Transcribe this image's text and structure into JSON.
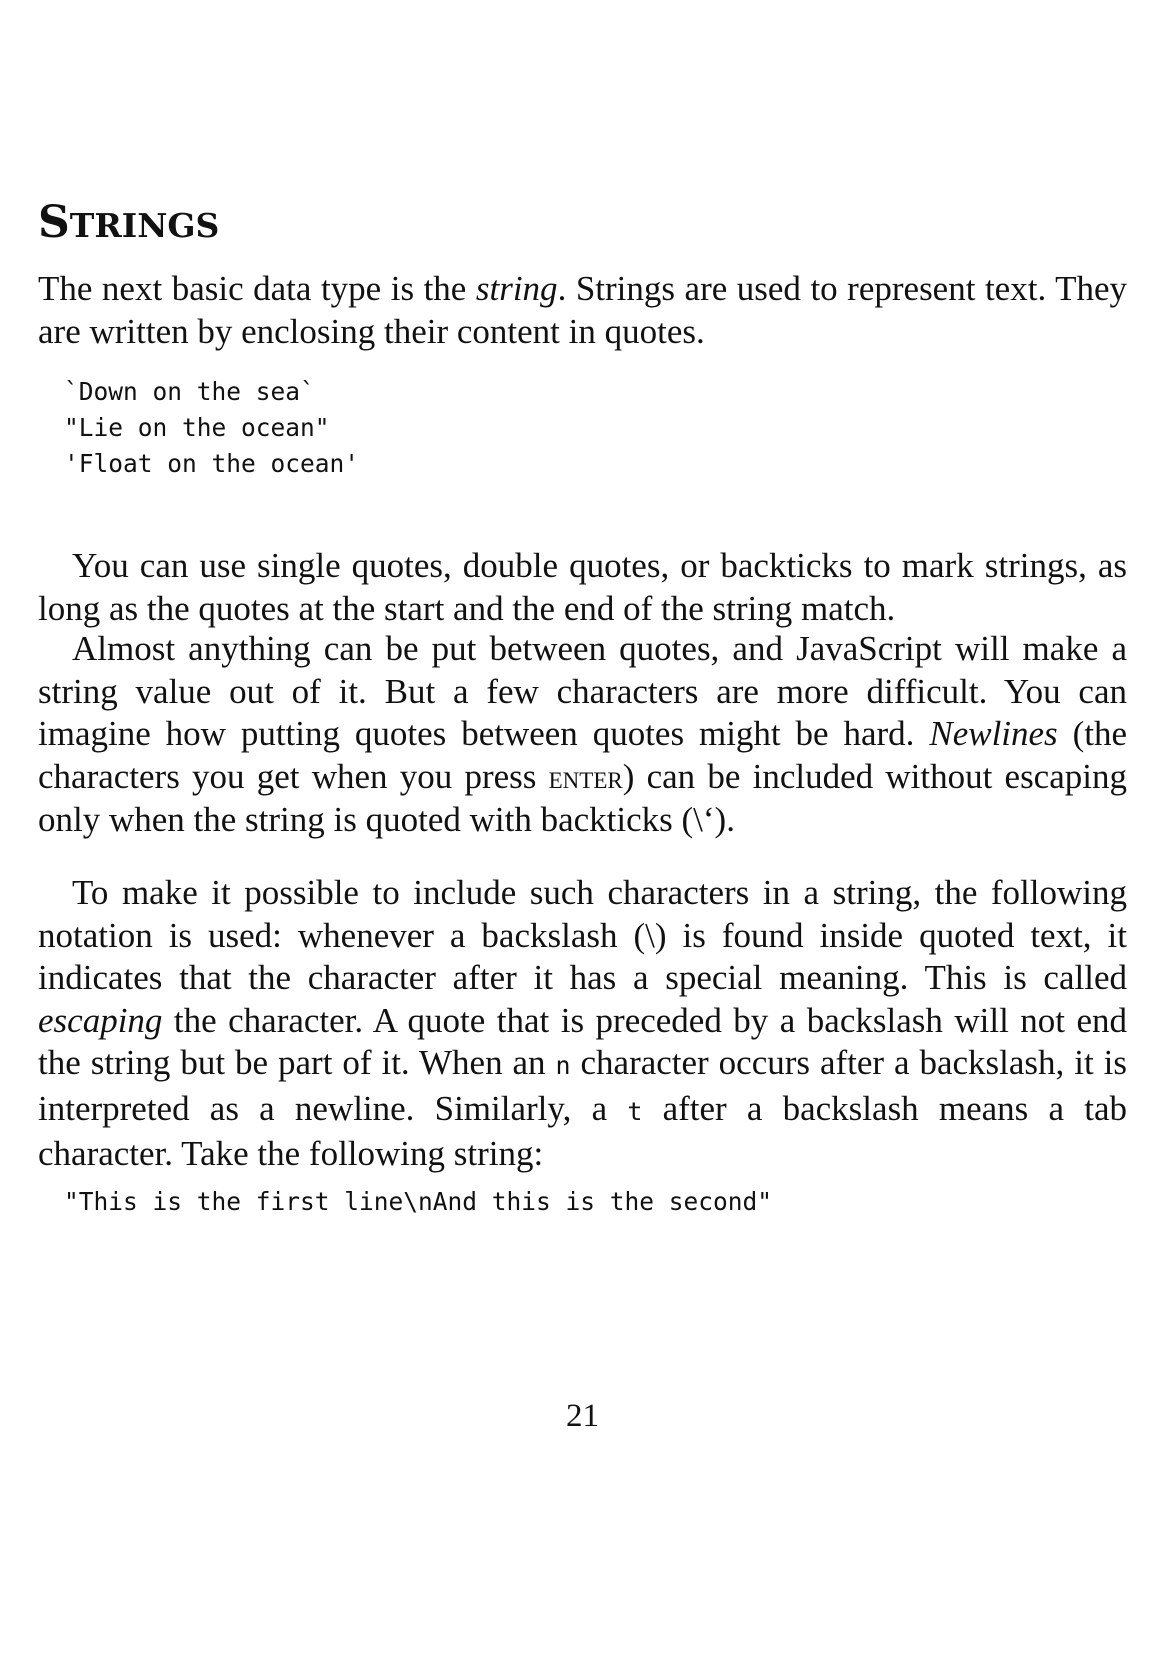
{
  "heading": {
    "first_letter": "S",
    "rest": "TRINGS"
  },
  "paragraph1": {
    "part1": "The next basic data type is the ",
    "em": "string",
    "part2": ". Strings are used to represent text. They are written by enclosing their content in quotes."
  },
  "code_block1": {
    "lines": [
      "`Down on the sea`",
      "\"Lie on the ocean\"",
      "'Float on the ocean'"
    ]
  },
  "paragraph2": {
    "text": "You can use single quotes, double quotes, or backticks to mark strings, as long as the quotes at the start and the end of the string match."
  },
  "paragraph3": {
    "part1": "Almost anything can be put between quotes, and JavaScript will make a string value out of it. But a few characters are more difficult. You can imagine how putting quotes between quotes might be hard. ",
    "em": "Newlines",
    "part2": " (the characters you get when you press ",
    "key": "ENTER",
    "part3": ") can be included without escaping only when the string is quoted with backticks (\\‘)."
  },
  "paragraph4": {
    "part1": "To make it possible to include such characters in a string, the following notation is used: whenever a backslash (\\) is found inside quoted text, it indicates that the character after it has a special meaning. This is called ",
    "em": "escaping",
    "part2": " the character. A quote that is preceded by a backslash will not end the string but be part of it. When an ",
    "code_n": "n",
    "part3": " character occurs after a backslash, it is interpreted as a newline. Similarly, a ",
    "code_t": "t",
    "part4": " after a backslash means a tab character. Take the following string:"
  },
  "code_block2": {
    "line": "\"This is the first line\\nAnd this is the second\""
  },
  "page_number": "21"
}
